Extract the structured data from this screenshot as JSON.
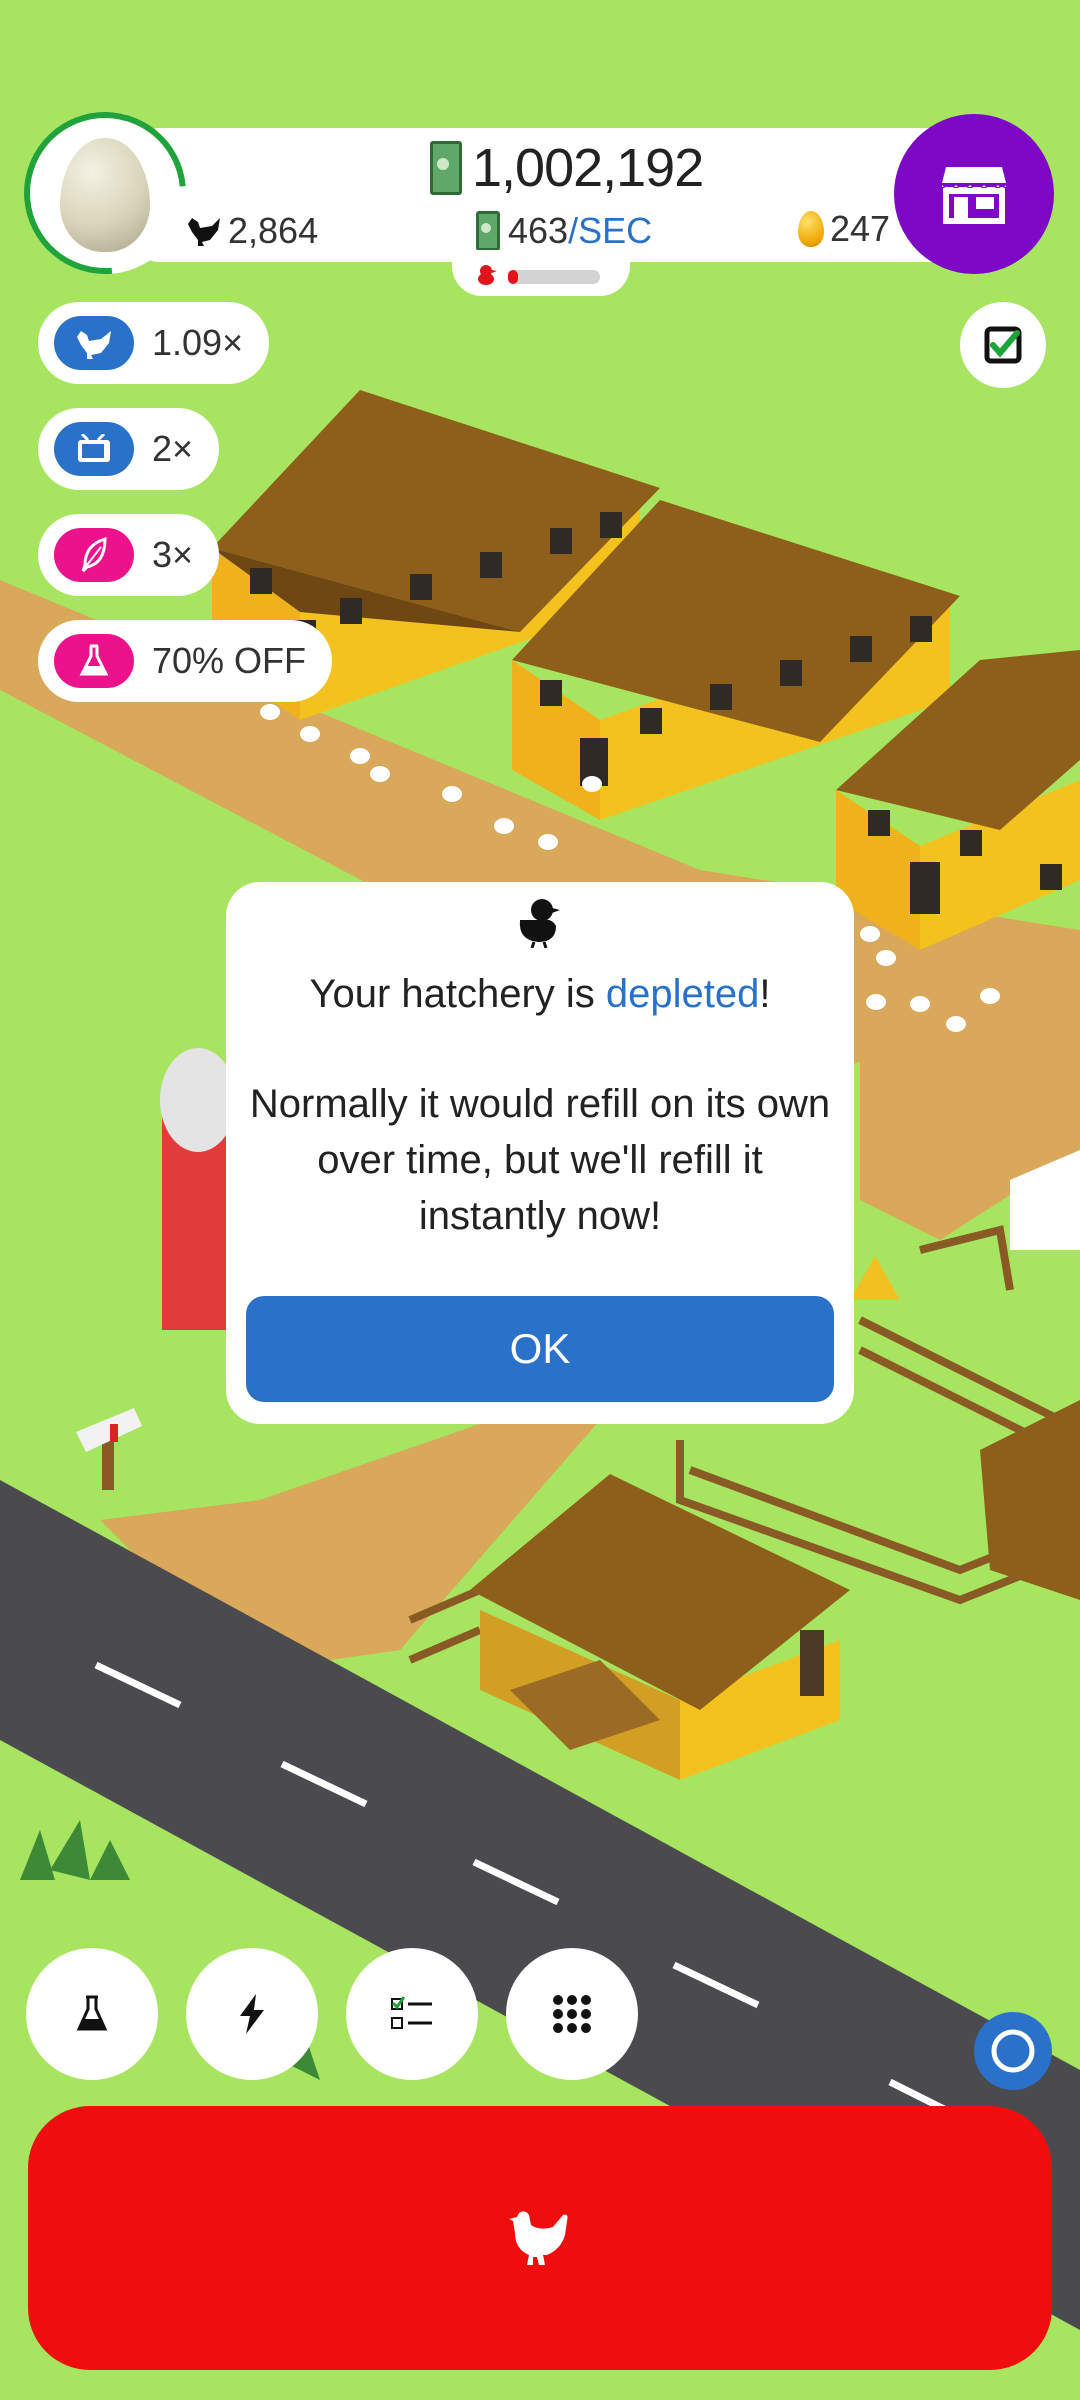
{
  "hud": {
    "money": "1,002,192",
    "chicken_count": "2,864",
    "rate_value": "463",
    "rate_unit": "/SEC",
    "golden_eggs": "247",
    "hatchery_fill": 0.05
  },
  "boosts": [
    {
      "label": "1.09×",
      "icon": "chicken-icon",
      "color": "#2a72c9"
    },
    {
      "label": "2×",
      "icon": "tv-icon",
      "color": "#2a72c9"
    },
    {
      "label": "3×",
      "icon": "feather-icon",
      "color": "#ec128b"
    },
    {
      "label": "70% OFF",
      "icon": "flask-icon",
      "color": "#ec128b"
    }
  ],
  "dialog": {
    "line1_prefix": "Your hatchery is ",
    "line1_highlight": "depleted",
    "line1_suffix": "!",
    "line2": "Normally it would refill on its own",
    "line3": "over time, but we'll refill it",
    "line4": "instantly now!",
    "ok_label": "OK"
  },
  "bottom_buttons": [
    "research-icon",
    "boost-icon",
    "missions-icon",
    "menu-grid-icon"
  ],
  "colors": {
    "grass": "#a7e560",
    "shop": "#7d08c5",
    "accent_blue": "#2a72c9",
    "hatch_red": "#ef0d0e"
  }
}
